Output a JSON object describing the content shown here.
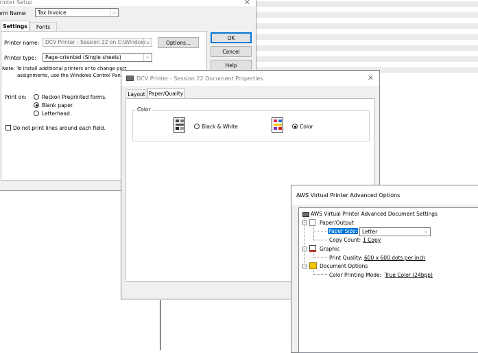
{
  "printer_setup": {
    "title": "Printer Setup",
    "form_name_label": "Form Name:",
    "form_name_value": "Tax Invoice",
    "tabs": [
      "Settings",
      "Fonts"
    ],
    "printer_name_label": "Printer name:",
    "printer_name_value": "DCV Printer - Session 22 on C:\\Window...",
    "options_button": "Options...",
    "printer_type_label": "Printer type:",
    "printer_type_value": "Page-oriented (Single sheets)",
    "note_line1": "Note: To install additional printers or to change port",
    "note_line2": "assignments, use the Windows Control Panel.",
    "print_on_label": "Print on:",
    "print_on_options": [
      "Reckon Preprinted forms.",
      "Blank paper.",
      "Letterhead."
    ],
    "do_not_print_lines": "Do not print lines around each field.",
    "ok_button": "OK",
    "cancel_button": "Cancel",
    "help_button": "Help"
  },
  "dcv_properties": {
    "title": "DCV Printer - Session 22 Document Properties",
    "tabs": [
      "Layout",
      "Paper/Quality"
    ],
    "color_group_label": "Color",
    "black_white_label": "Black & White",
    "color_label": "Color"
  },
  "aws_advanced": {
    "title": "AWS Virtual Printer Advanced Options",
    "root_label": "AWS Virtual Printer Advanced Document Settings",
    "paper_output_label": "Paper/Output",
    "paper_size_label": "Paper Size:",
    "paper_size_value": "Letter",
    "copy_count_label": "Copy Count:",
    "copy_count_value": "1 Copy",
    "graphic_label": "Graphic",
    "print_quality_label": "Print Quality:",
    "print_quality_value": "600 x 600 dots per inch",
    "document_options_label": "Document Options",
    "color_printing_mode_label": "Color Printing Mode:",
    "color_printing_mode_value": "True Color (24bpp)"
  },
  "colors": {
    "selection": "#0078d7",
    "dialog_bg": "#f0f0f0"
  }
}
